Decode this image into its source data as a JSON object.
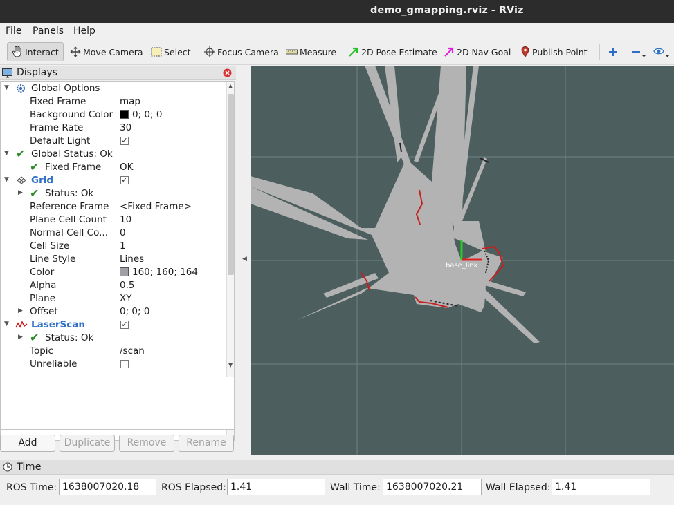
{
  "window": {
    "title": "demo_gmapping.rviz - RViz"
  },
  "menubar": {
    "items": [
      "File",
      "Panels",
      "Help"
    ]
  },
  "toolbar": {
    "tools": [
      {
        "label": "Interact",
        "icon": "hand-cursor-icon"
      },
      {
        "label": "Move Camera",
        "icon": "move-arrows-icon"
      },
      {
        "label": "Select",
        "icon": "selection-box-icon"
      },
      {
        "label": "Focus Camera",
        "icon": "crosshair-icon"
      },
      {
        "label": "Measure",
        "icon": "ruler-icon"
      },
      {
        "label": "2D Pose Estimate",
        "icon": "green-arrow-icon"
      },
      {
        "label": "2D Nav Goal",
        "icon": "magenta-arrow-icon"
      },
      {
        "label": "Publish Point",
        "icon": "map-pin-icon"
      }
    ],
    "extra_icons": [
      "plus-icon",
      "minus-icon",
      "eye-icon"
    ]
  },
  "displays": {
    "title": "Displays",
    "rows": [
      {
        "name": "Global Options",
        "value": ""
      },
      {
        "name": "Fixed Frame",
        "value": "map"
      },
      {
        "name": "Background Color",
        "value": "0; 0; 0",
        "swatch": "#000000"
      },
      {
        "name": "Frame Rate",
        "value": "30"
      },
      {
        "name": "Default Light",
        "value": "",
        "checked": true
      },
      {
        "name": "Global Status: Ok",
        "value": ""
      },
      {
        "name": "Fixed Frame",
        "value": "OK"
      },
      {
        "name": "Grid",
        "value": "",
        "checked": true
      },
      {
        "name": "Status: Ok",
        "value": ""
      },
      {
        "name": "Reference Frame",
        "value": "<Fixed Frame>"
      },
      {
        "name": "Plane Cell Count",
        "value": "10"
      },
      {
        "name": "Normal Cell Co...",
        "value": "0"
      },
      {
        "name": "Cell Size",
        "value": "1"
      },
      {
        "name": "Line Style",
        "value": "Lines"
      },
      {
        "name": "Color",
        "value": "160; 160; 164",
        "swatch": "#a0a0a4"
      },
      {
        "name": "Alpha",
        "value": "0.5"
      },
      {
        "name": "Plane",
        "value": "XY"
      },
      {
        "name": "Offset",
        "value": "0; 0; 0"
      },
      {
        "name": "LaserScan",
        "value": "",
        "checked": true
      },
      {
        "name": "Status: Ok",
        "value": ""
      },
      {
        "name": "Topic",
        "value": "/scan"
      },
      {
        "name": "Unreliable",
        "value": "",
        "checked": false
      }
    ],
    "buttons": [
      "Add",
      "Duplicate",
      "Remove",
      "Rename"
    ]
  },
  "viewport": {
    "background_color": "#4d5e5e",
    "robot_label": "base_link"
  },
  "time": {
    "title": "Time",
    "ros_time_label": "ROS Time:",
    "ros_time": "1638007020.18",
    "ros_elapsed_label": "ROS Elapsed:",
    "ros_elapsed": "1.41",
    "wall_time_label": "Wall Time:",
    "wall_time": "1638007020.21",
    "wall_elapsed_label": "Wall Elapsed:",
    "wall_elapsed": "1.41"
  }
}
